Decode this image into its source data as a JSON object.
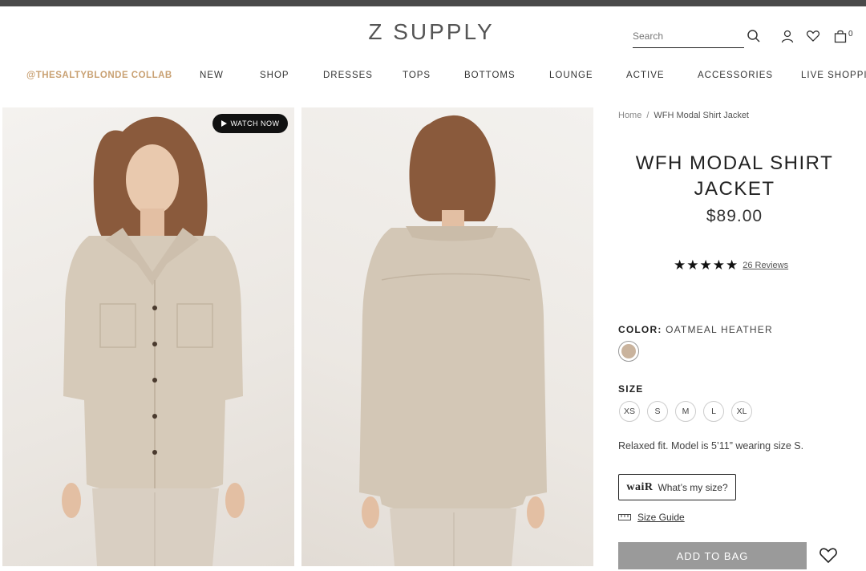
{
  "header": {
    "logo": "Z SUPPLY",
    "search_placeholder": "Search",
    "bag_count": "0"
  },
  "nav": {
    "items": [
      "@THESALTYBLONDE COLLAB",
      "NEW",
      "SHOP",
      "DRESSES",
      "TOPS",
      "BOTTOMS",
      "LOUNGE",
      "ACTIVE",
      "ACCESSORIES",
      "LIVE SHOPPIN"
    ]
  },
  "media": {
    "watch_label": "WATCH NOW"
  },
  "breadcrumb": {
    "home": "Home",
    "separator": "/",
    "current": "WFH Modal Shirt Jacket"
  },
  "product": {
    "title": "WFH MODAL SHIRT JACKET",
    "price": "$89.00",
    "rating": 5,
    "reviews_label": "26 Reviews",
    "color_label": "COLOR:",
    "color_value": "OATMEAL HEATHER",
    "swatch_color": "#c9b39d",
    "size_label": "SIZE",
    "sizes": [
      "XS",
      "S",
      "M",
      "L",
      "XL"
    ],
    "fit_note": "Relaxed fit. Model is 5’11” wearing size S.",
    "wair_logo": "waiR",
    "wair_text": "What’s my size?",
    "size_guide": "Size Guide",
    "add_to_bag": "ADD TO BAG"
  },
  "colors": {
    "accent_collab": "#c9a173",
    "button_disabled": "#9a9a9a",
    "topbar": "#4a4a4a"
  }
}
